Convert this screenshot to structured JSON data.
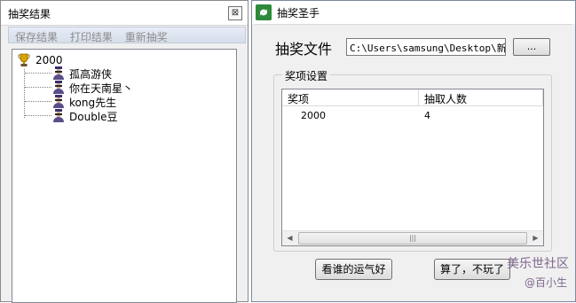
{
  "left_window": {
    "title": "抽奖结果",
    "close_glyph": "⊠",
    "menu": [
      "保存结果",
      "打印结果",
      "重新抽奖"
    ],
    "tree": {
      "root": "2000",
      "root_icon": "trophy-icon",
      "children": [
        "孤高游侠",
        "你在天南星丶",
        "kong先生",
        "Double豆"
      ],
      "child_icon": "user-icon"
    }
  },
  "right_window": {
    "title": "抽奖圣手",
    "app_icon": "refresh-icon",
    "file_label": "抽奖文件",
    "file_path": "C:\\Users\\samsung\\Desktop\\新建",
    "browse_label": "...",
    "group_title": "奖项设置",
    "columns": [
      "奖项",
      "抽取人数"
    ],
    "rows": [
      [
        "2000",
        "4"
      ]
    ],
    "scroll_thumb_glyph": "|||",
    "buttons": {
      "lucky": "看谁的运气好",
      "quit": "算了，不玩了"
    }
  },
  "watermark": {
    "line1": "美乐世社区",
    "line2": "@百小生"
  },
  "colors": {
    "accent": "#2e8a3a",
    "menu_disabled_text": "#8c8c8c"
  }
}
